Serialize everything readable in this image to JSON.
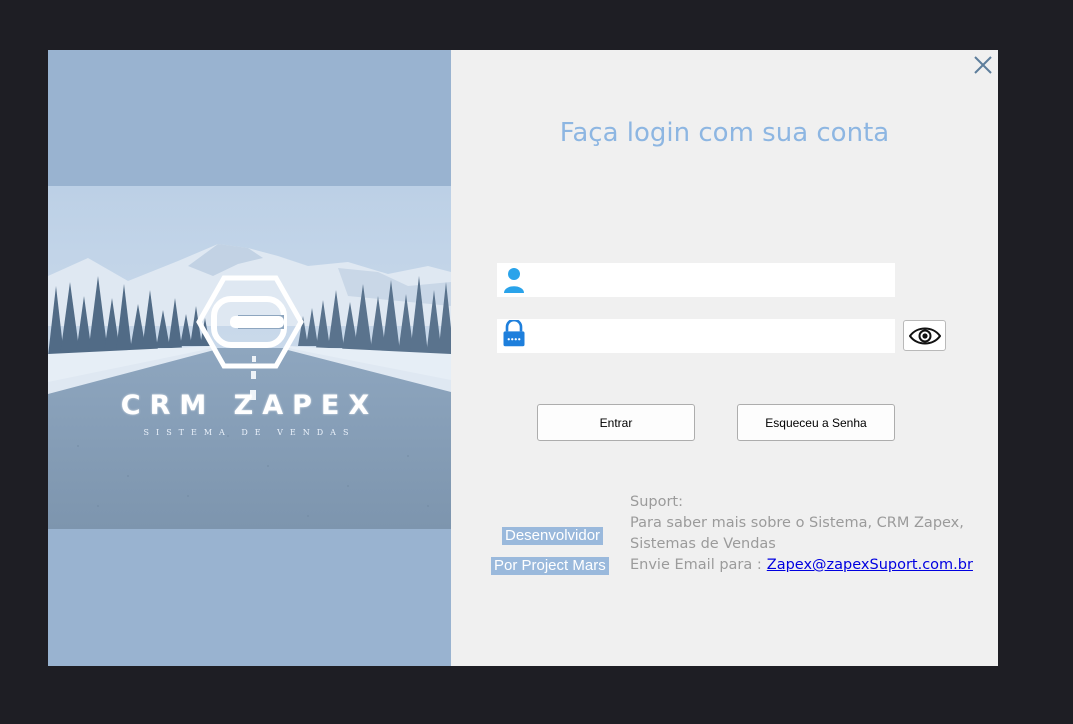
{
  "brand": {
    "title": "CRM ZAPEX",
    "subtitle": "SISTEMA DE VENDAS"
  },
  "login": {
    "heading": "Faça login com sua conta",
    "username_value": "",
    "password_value": "",
    "enter_button": "Entrar",
    "forgot_button": "Esqueceu a Senha"
  },
  "developer": {
    "line1": "Desenvolvidor",
    "line2": "Por Project Mars"
  },
  "support": {
    "title": "Suport:",
    "line1": "Para saber mais sobre o Sistema, CRM Zapex,",
    "line2": "Sistemas de Vendas",
    "email_prefix": "Envie Email para :",
    "email": "Zapex@zapexSuport.com.br"
  },
  "colors": {
    "page_background": "#1e1e24",
    "left_panel": "#99b3d0",
    "form_background": "#f0f0f0",
    "heading": "#8db6e2",
    "user_icon": "#2aa3ea",
    "lock_icon": "#1e7fdc",
    "link": "#0000e0"
  },
  "icons": {
    "close": "close-icon",
    "user": "user-icon",
    "lock": "lock-icon",
    "eye": "eye-icon",
    "logo": "crm-zapex-logo"
  }
}
